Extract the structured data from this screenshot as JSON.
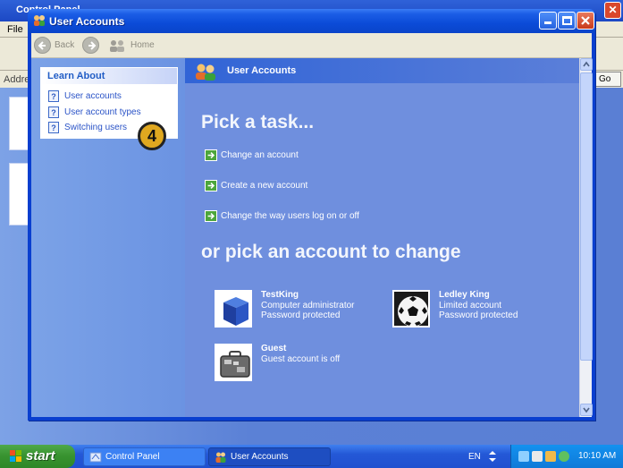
{
  "background_window": {
    "title": "Control Panel",
    "menu_file": "File",
    "address_label": "Addre",
    "go_label": "Go"
  },
  "window": {
    "title": "User Accounts"
  },
  "nav": {
    "back": "Back",
    "home": "Home"
  },
  "learn_about": {
    "heading": "Learn About",
    "items": [
      "User accounts",
      "User account types",
      "Switching users"
    ]
  },
  "banner": {
    "title": "User Accounts"
  },
  "tasks": {
    "heading": "Pick a task...",
    "items": [
      "Change an account",
      "Create a new account",
      "Change the way users log on or off"
    ]
  },
  "step_marker": "4",
  "accounts": {
    "heading": "or pick an account to change",
    "items": [
      {
        "name": "TestKing",
        "line1": "Computer administrator",
        "line2": "Password protected"
      },
      {
        "name": "Ledley King",
        "line1": "Limited account",
        "line2": "Password protected"
      },
      {
        "name": "Guest",
        "line1": "Guest account is off",
        "line2": ""
      }
    ]
  },
  "taskbar": {
    "start": "start",
    "buttons": [
      "Control Panel",
      "User Accounts"
    ],
    "language": "EN",
    "clock": "10:10 AM"
  },
  "colors": {
    "accent_blue": "#0a44c9",
    "task_arrow_green": "#4ca63c",
    "right_pane_bg": "#6f8fde",
    "start_green": "#37922f",
    "step_badge": "#e0a820"
  }
}
